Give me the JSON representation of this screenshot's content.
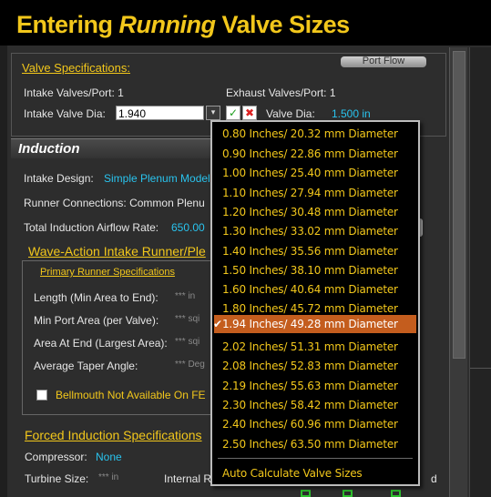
{
  "banner": {
    "prefix": "Entering ",
    "italic": "Running",
    "suffix": " Valve Sizes"
  },
  "valve_specs": {
    "header": "Valve Specifications:",
    "port_flow_button": "Port Flow",
    "intake_valves_port": "Intake Valves/Port:  1",
    "exhaust_valves_port": "Exhaust Valves/Port:  1",
    "intake_valve_dia_label": "Intake Valve Dia:",
    "intake_valve_dia_value": "1.940",
    "valve_dia_label": "Valve Dia:",
    "valve_dia_value": "1.500 in"
  },
  "induction": {
    "title": "Induction",
    "intake_design_label": "Intake Design:",
    "intake_design_value": "Simple Plenum Model",
    "runner_connections": "Runner Connections:  Common Plenu",
    "total_airflow_label": "Total Induction Airflow Rate:",
    "total_airflow_value": "650.00",
    "wave_header": "Wave-Action Intake Runner/Ple",
    "primary_header": "Primary Runner Specifications",
    "rows": [
      {
        "label": "Length (Min Area to End):",
        "value": "*** in"
      },
      {
        "label": "Min Port Area (per Valve):",
        "value": "*** sqi"
      },
      {
        "label": "Area At End (Largest Area):",
        "value": "*** sqi"
      },
      {
        "label": "Average Taper Angle:",
        "value": "*** Deg"
      }
    ],
    "bellmouth_label": "Bellmouth Not Available On FE"
  },
  "forced": {
    "header": "Forced Induction Specifications",
    "compressor_label": "Compressor:",
    "compressor_value": "None",
    "turbine_label": "Turbine Size:",
    "turbine_value": "*** in",
    "internal_label": "Internal R",
    "d_label": "d"
  },
  "dropdown": {
    "items": [
      "0.80 Inches/ 20.32 mm Diameter",
      "0.90 Inches/ 22.86 mm Diameter",
      "1.00 Inches/ 25.40 mm Diameter",
      "1.10 Inches/ 27.94 mm Diameter",
      "1.20 Inches/ 30.48 mm Diameter",
      "1.30 Inches/ 33.02 mm Diameter",
      "1.40 Inches/ 35.56 mm Diameter",
      "1.50 Inches/ 38.10 mm Diameter",
      "1.60 Inches/ 40.64 mm Diameter",
      "1.80 Inches/ 45.72 mm Diameter",
      "1.94 Inches/ 49.28 mm Diameter",
      "2.02 Inches/ 51.31 mm Diameter",
      "2.08 Inches/ 52.83 mm Diameter",
      "2.19 Inches/ 55.63 mm Diameter",
      "2.30 Inches/ 58.42 mm Diameter",
      "2.40 Inches/ 60.96 mm Diameter",
      "2.50 Inches/ 63.50 mm Diameter"
    ],
    "selected_index": 10,
    "auto_calc": "Auto Calculate Valve Sizes"
  },
  "colors": {
    "accent": "#f2c71b",
    "highlight": "#c45d1e",
    "value_text": "#29c3ee"
  }
}
